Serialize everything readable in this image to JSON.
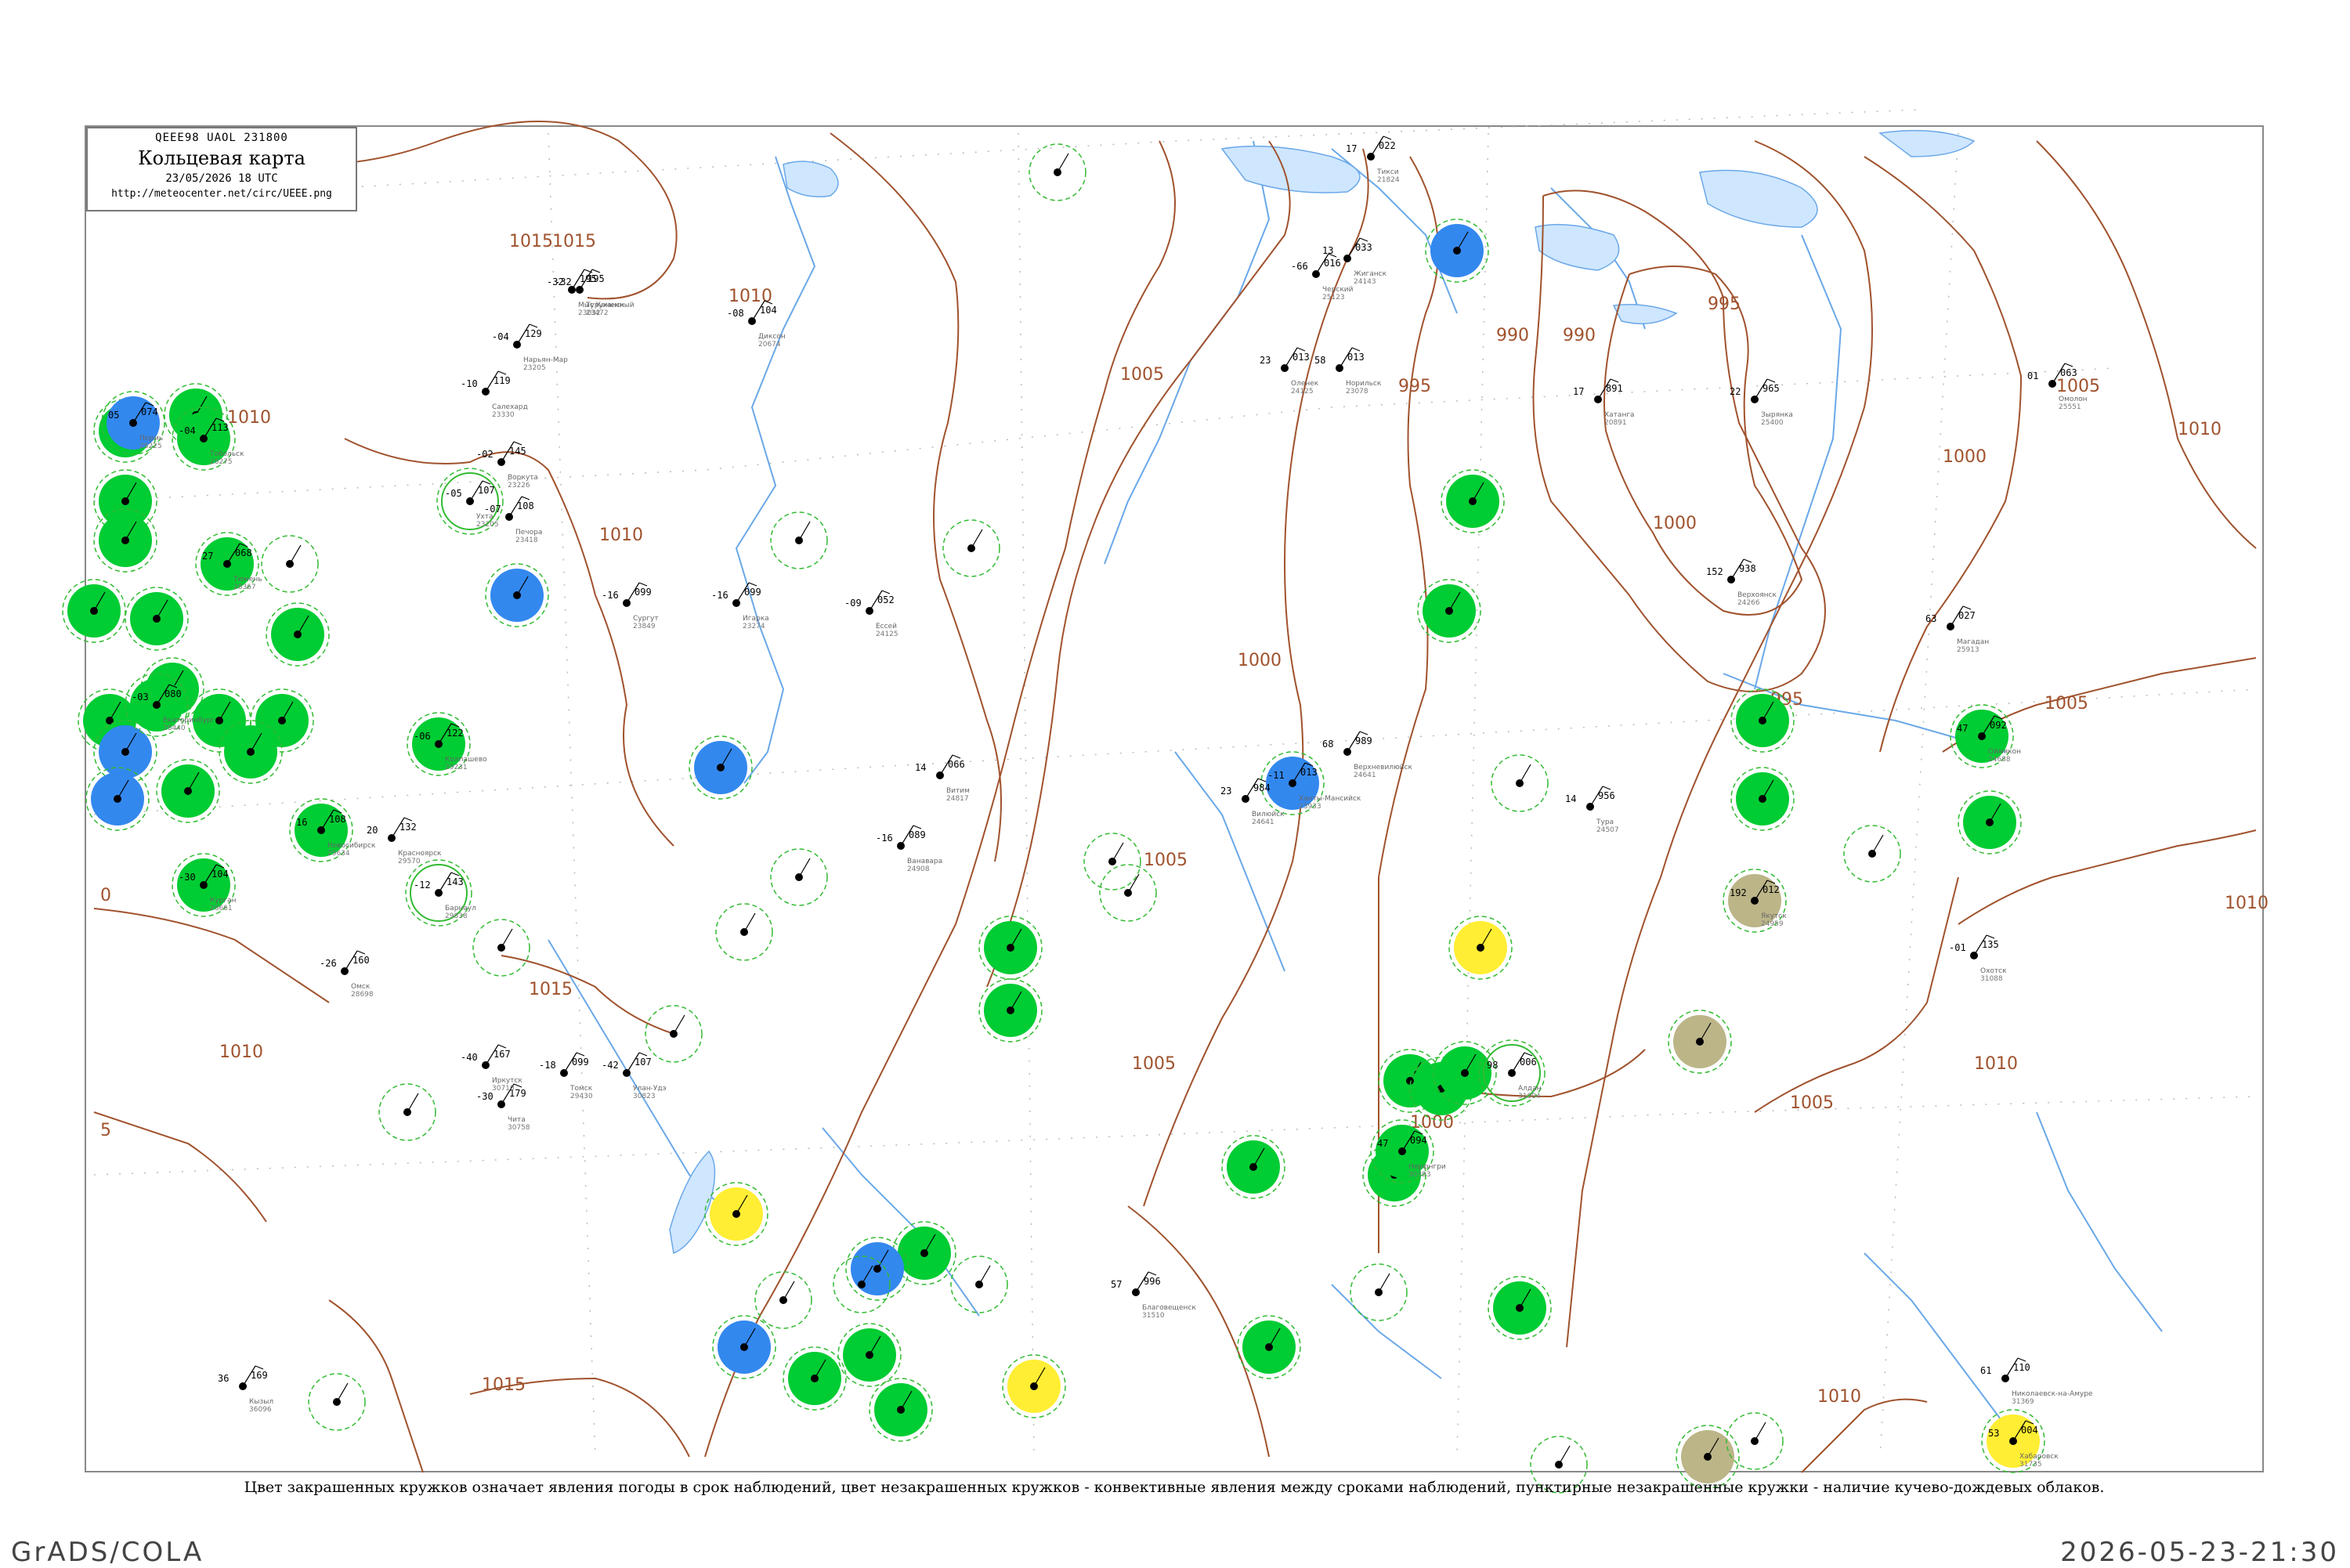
{
  "header": {
    "code_line": "QEEE98  UAOL  231800",
    "title": "Кольцевая карта",
    "date_line": "23/05/2026 18 UTC",
    "url": "http://meteocenter.net/circ/UEEE.png"
  },
  "caption": "Цвет закрашенных кружков означает явления погоды в срок наблюдений, цвет незакрашенных кружков - конвективные явления между сроками наблюдений, пунктирные незакрашенные кружки - наличие кучево-дождевых облаков.",
  "footer": {
    "left": "GrADS/COLA",
    "right": "2026-05-23-21:30"
  },
  "colors": {
    "isobar": "#a0522d",
    "rain": "#00cc33",
    "snow": "#3388ee",
    "fog": "#ffee33",
    "dust": "#bbb588",
    "thunder_ring": "#33bb33",
    "water": "#6aa8e8"
  },
  "isobar_labels": [
    "1015",
    "1010",
    "1010",
    "1010",
    "1005",
    "1000",
    "995",
    "990",
    "995",
    "1000",
    "1005",
    "1010",
    "1005",
    "1000",
    "1005",
    "1010",
    "1015",
    "1015",
    "1015",
    "1000",
    "1010",
    "1005",
    "1010",
    "995",
    "990",
    "1010",
    "1005",
    "5",
    "0"
  ],
  "stations": [
    {
      "name": "Колпашево",
      "id": "29231",
      "pressure": "122",
      "temp": "-06",
      "weather": "rain"
    },
    {
      "name": "Сургут",
      "id": "23849",
      "pressure": "099",
      "temp": "-16",
      "weather": "none"
    },
    {
      "name": "Тура",
      "id": "24507",
      "pressure": "956",
      "temp": "14",
      "weather": "none"
    },
    {
      "name": "Туруханск",
      "id": "23472",
      "pressure": "195",
      "temp": "-32",
      "weather": "none"
    },
    {
      "name": "Ханты-Мансийск",
      "id": "23933",
      "pressure": "013",
      "temp": "-11",
      "weather": "snow"
    },
    {
      "name": "Верхневилюйск",
      "id": "24641",
      "pressure": "989",
      "temp": "68",
      "weather": "none"
    },
    {
      "name": "Хатанга",
      "id": "20891",
      "pressure": "891",
      "temp": "17",
      "weather": "none"
    },
    {
      "name": "Оленек",
      "id": "24125",
      "pressure": "013",
      "temp": "23",
      "weather": "none"
    },
    {
      "name": "Нарьян-Мар",
      "id": "23205",
      "pressure": "129",
      "temp": "-04",
      "weather": "none"
    },
    {
      "name": "Салехард",
      "id": "23330",
      "pressure": "119",
      "temp": "-10",
      "weather": "none"
    },
    {
      "name": "Якутск",
      "id": "24959",
      "pressure": "012",
      "temp": "192",
      "weather": "dust"
    },
    {
      "name": "Витим",
      "id": "24817",
      "pressure": "066",
      "temp": "14",
      "weather": "none"
    },
    {
      "name": "Ванавара",
      "id": "24908",
      "pressure": "089",
      "temp": "-16",
      "weather": "none"
    },
    {
      "name": "Алдан",
      "id": "31004",
      "pressure": "006",
      "temp": "98",
      "weather": "thunder"
    },
    {
      "name": "Верхоянск",
      "id": "24266",
      "pressure": "938",
      "temp": "152",
      "weather": "none"
    },
    {
      "name": "Оймякон",
      "id": "24688",
      "pressure": "092",
      "temp": "47",
      "weather": "rain"
    },
    {
      "name": "Зырянка",
      "id": "25400",
      "pressure": "965",
      "temp": "22",
      "weather": "none"
    },
    {
      "name": "Черский",
      "id": "25123",
      "pressure": "016",
      "temp": "-66",
      "weather": "none"
    },
    {
      "name": "Омолон",
      "id": "25551",
      "pressure": "063",
      "temp": "01",
      "weather": "none"
    },
    {
      "name": "Чита",
      "id": "30758",
      "pressure": "179",
      "temp": "-30",
      "weather": "none"
    },
    {
      "name": "Иркутск",
      "id": "30710",
      "pressure": "167",
      "temp": "-40",
      "weather": "none"
    },
    {
      "name": "Улан-Удэ",
      "id": "30823",
      "pressure": "107",
      "temp": "-42",
      "weather": "none"
    },
    {
      "name": "Благовещенск",
      "id": "31510",
      "pressure": "996",
      "temp": "57",
      "weather": "none"
    },
    {
      "name": "Хабаровск",
      "id": "31735",
      "pressure": "004",
      "temp": "53",
      "weather": "fog"
    },
    {
      "name": "Омск",
      "id": "28698",
      "pressure": "160",
      "temp": "-26",
      "weather": "none"
    },
    {
      "name": "Новосибирск",
      "id": "29634",
      "pressure": "108",
      "temp": "16",
      "weather": "rain"
    },
    {
      "name": "Барнаул",
      "id": "29838",
      "pressure": "143",
      "temp": "-12",
      "weather": "thunder"
    },
    {
      "name": "Красноярск",
      "id": "29570",
      "pressure": "132",
      "temp": "20",
      "weather": "none"
    },
    {
      "name": "Кызыл",
      "id": "36096",
      "pressure": "169",
      "temp": "36",
      "weather": "none"
    },
    {
      "name": "Томск",
      "id": "29430",
      "pressure": "099",
      "temp": "-18",
      "weather": "none"
    },
    {
      "name": "Тобольск",
      "id": "28275",
      "pressure": "113",
      "temp": "-04",
      "weather": "rain"
    },
    {
      "name": "Тюмень",
      "id": "28367",
      "pressure": "068",
      "temp": "27",
      "weather": "rain"
    },
    {
      "name": "Курган",
      "id": "28661",
      "pressure": "104",
      "temp": "-30",
      "weather": "rain"
    },
    {
      "name": "Екатеринбург",
      "id": "28440",
      "pressure": "080",
      "temp": "-03",
      "weather": "rain"
    },
    {
      "name": "Пермь",
      "id": "28225",
      "pressure": "074",
      "temp": "05",
      "weather": "snow"
    },
    {
      "name": "Ухта",
      "id": "23205",
      "pressure": "107",
      "temp": "-05",
      "weather": "thunder"
    },
    {
      "name": "Печора",
      "id": "23418",
      "pressure": "108",
      "temp": "-07",
      "weather": "none"
    },
    {
      "name": "Воркута",
      "id": "23226",
      "pressure": "145",
      "temp": "-02",
      "weather": "none"
    },
    {
      "name": "Мыс Каменный",
      "id": "23032",
      "pressure": "195",
      "temp": "-32",
      "weather": "none"
    },
    {
      "name": "Диксон",
      "id": "20674",
      "pressure": "104",
      "temp": "-08",
      "weather": "none"
    },
    {
      "name": "Норильск",
      "id": "23078",
      "pressure": "013",
      "temp": "58",
      "weather": "none"
    },
    {
      "name": "Игарка",
      "id": "23274",
      "pressure": "099",
      "temp": "-16",
      "weather": "none"
    },
    {
      "name": "Ессей",
      "id": "24125",
      "pressure": "052",
      "temp": "-09",
      "weather": "none"
    },
    {
      "name": "Тикси",
      "id": "21824",
      "pressure": "022",
      "temp": "17",
      "weather": "none"
    },
    {
      "name": "Жиганск",
      "id": "24143",
      "pressure": "033",
      "temp": "13",
      "weather": "none"
    },
    {
      "name": "Вилюйск",
      "id": "24641",
      "pressure": "984",
      "temp": "23",
      "weather": "none"
    },
    {
      "name": "Нерюнгри",
      "id": "30393",
      "pressure": "094",
      "temp": "47",
      "weather": "rain"
    },
    {
      "name": "Магадан",
      "id": "25913",
      "pressure": "027",
      "temp": "63",
      "weather": "none"
    },
    {
      "name": "Охотск",
      "id": "31088",
      "pressure": "135",
      "temp": "-01",
      "weather": "none"
    },
    {
      "name": "Николаевск-на-Амуре",
      "id": "31369",
      "pressure": "110",
      "temp": "61",
      "weather": "none"
    }
  ]
}
